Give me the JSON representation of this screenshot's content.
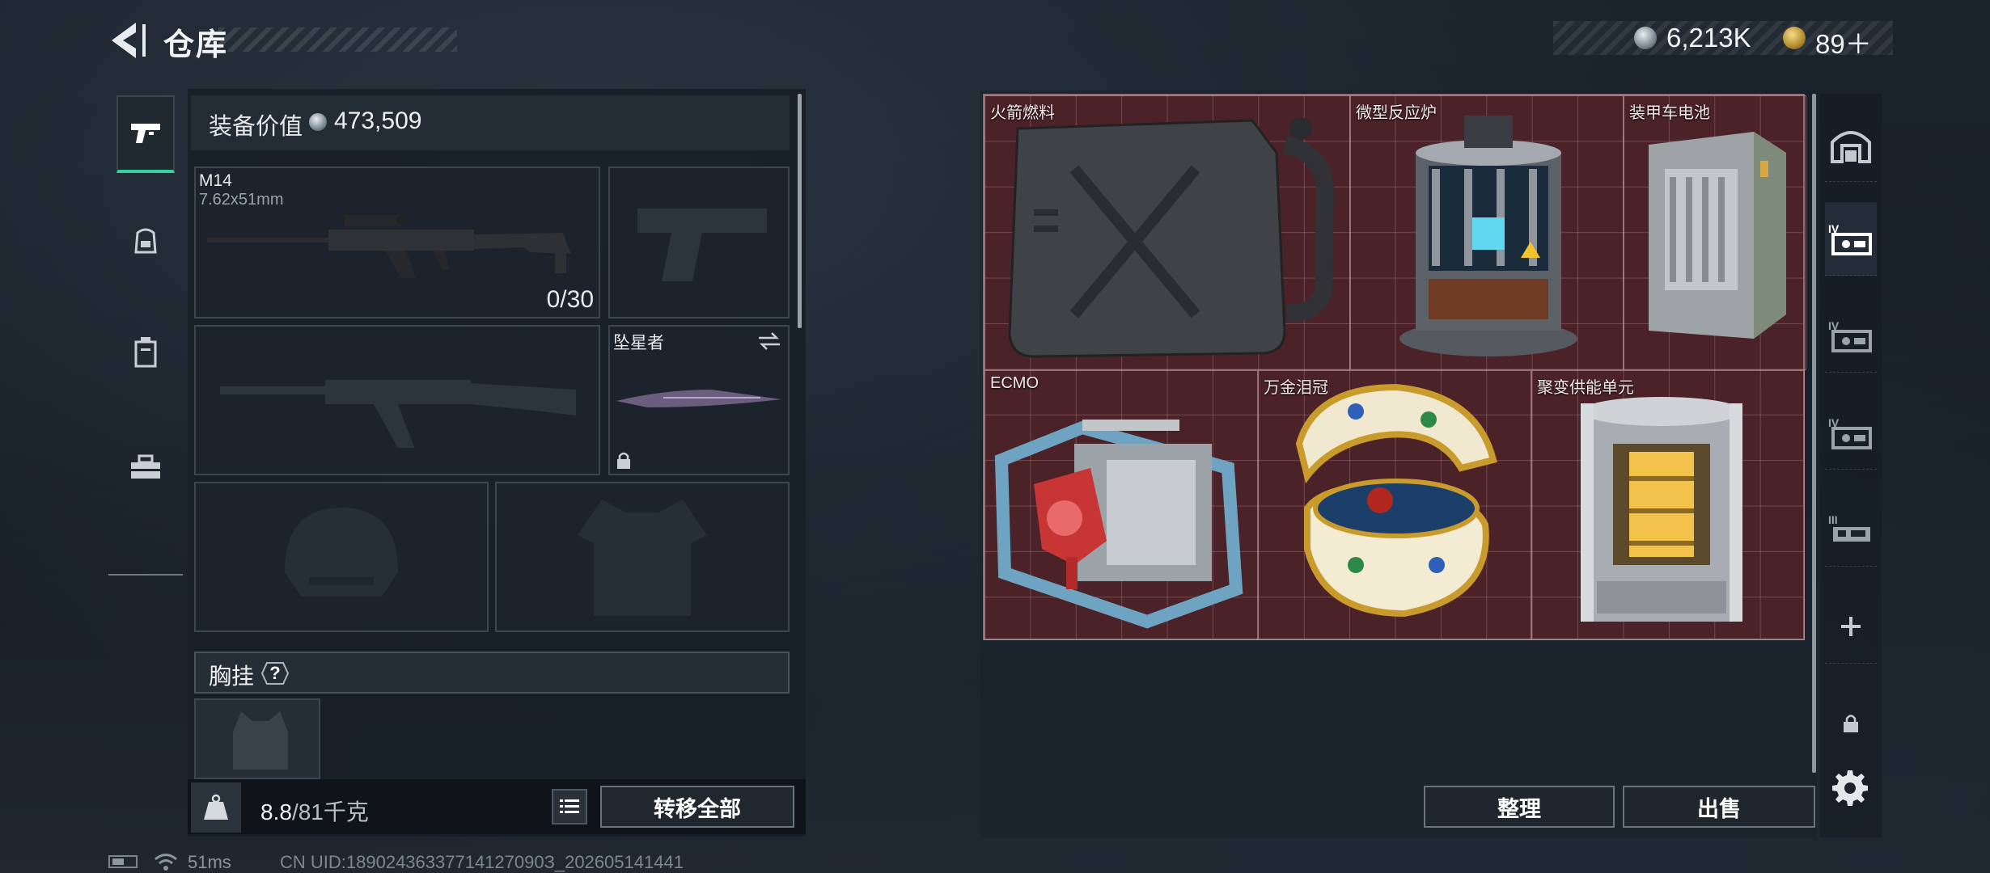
{
  "header": {
    "title": "仓库",
    "currencies": [
      {
        "icon": "silver-coin-icon",
        "value": "6,213K"
      },
      {
        "icon": "gold-coin-icon",
        "value": "89＋"
      }
    ]
  },
  "left_tabs": [
    {
      "icon": "pistol-icon",
      "active": true
    },
    {
      "icon": "backpack-icon",
      "active": false
    },
    {
      "icon": "locker-icon",
      "active": false
    },
    {
      "icon": "toolbox-icon",
      "active": false
    }
  ],
  "equipment": {
    "value_label": "装备价值",
    "value": "473,509",
    "primary": {
      "name": "M14",
      "caliber": "7.62x51mm",
      "ammo": "0/30"
    },
    "melee": {
      "name": "坠星者"
    },
    "rig_label": "胸挂",
    "rig_help": "?",
    "weight_value": "8.8",
    "weight_max": "/81千克",
    "transfer_all": "转移全部"
  },
  "storage": {
    "items": [
      {
        "name": "火箭燃料",
        "icon": "fuel-can-icon"
      },
      {
        "name": "微型反应炉",
        "icon": "reactor-icon"
      },
      {
        "name": "装甲车电池",
        "icon": "battery-icon"
      },
      {
        "name": "ECMO",
        "icon": "ecmo-machine-icon"
      },
      {
        "name": "万金泪冠",
        "icon": "jeweled-egg-icon"
      },
      {
        "name": "聚变供能单元",
        "icon": "fusion-cell-icon"
      }
    ],
    "sort": "整理",
    "sell": "出售"
  },
  "right_tabs": [
    {
      "icon": "home-storage-icon",
      "active": false
    },
    {
      "icon": "case-tier-iv-icon",
      "active": true
    },
    {
      "icon": "case-tier-iv-icon",
      "active": false
    },
    {
      "icon": "case-tier-iv-icon",
      "active": false
    },
    {
      "icon": "case-tier-iii-icon",
      "active": false
    },
    {
      "icon": "plus-icon",
      "active": false
    },
    {
      "icon": "lock-icon",
      "active": false
    }
  ],
  "status": {
    "ping": "51ms",
    "uid": "CN UID:18902436337714127090З_202605141441"
  },
  "colors": {
    "accent_green": "#37d39a",
    "grid_red": "#4a2228"
  }
}
